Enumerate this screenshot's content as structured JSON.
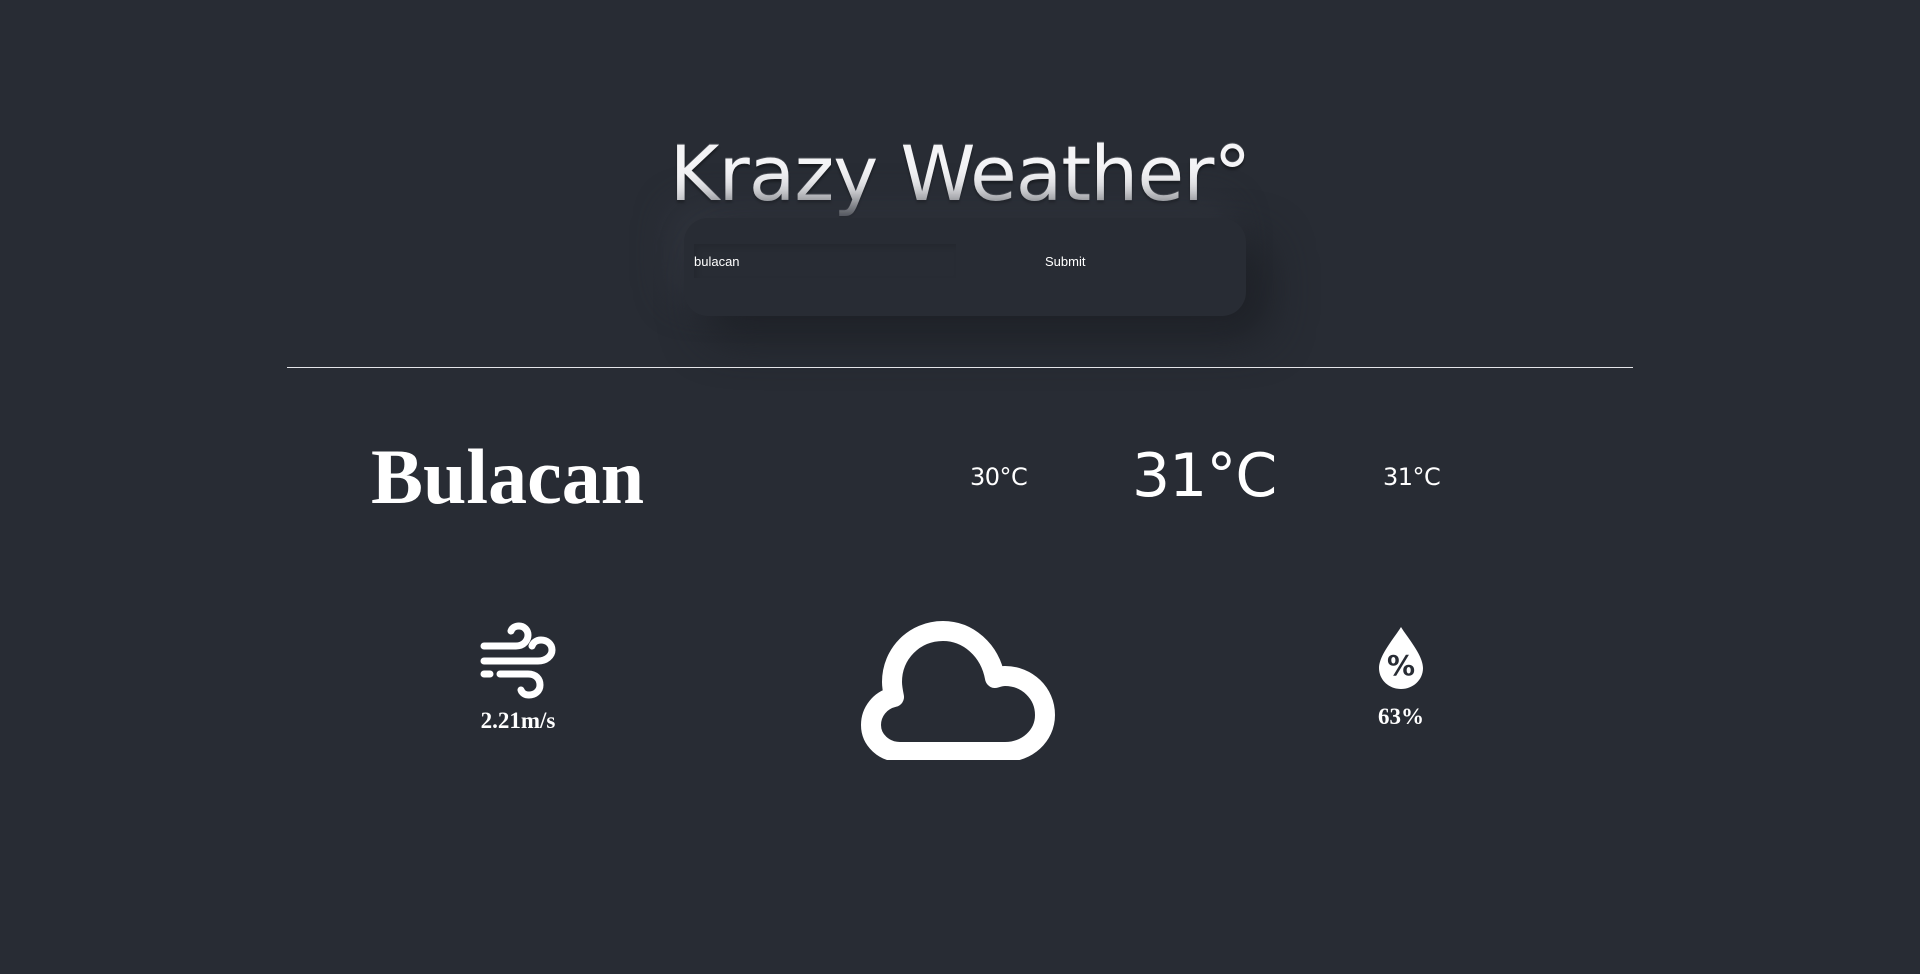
{
  "app": {
    "title": "Krazy Weather°"
  },
  "search": {
    "value": "bulacan",
    "submit_label": "Submit"
  },
  "weather": {
    "city": "Bulacan",
    "temp_min": "30°C",
    "temp_current": "31°C",
    "temp_max": "31°C",
    "wind_speed": "2.21m/s",
    "humidity": "63%",
    "condition_icon": "cloud-icon",
    "wind_icon": "wind-icon",
    "humidity_icon": "humidity-drop-icon"
  },
  "colors": {
    "background": "#282c34",
    "text": "#ffffff"
  }
}
